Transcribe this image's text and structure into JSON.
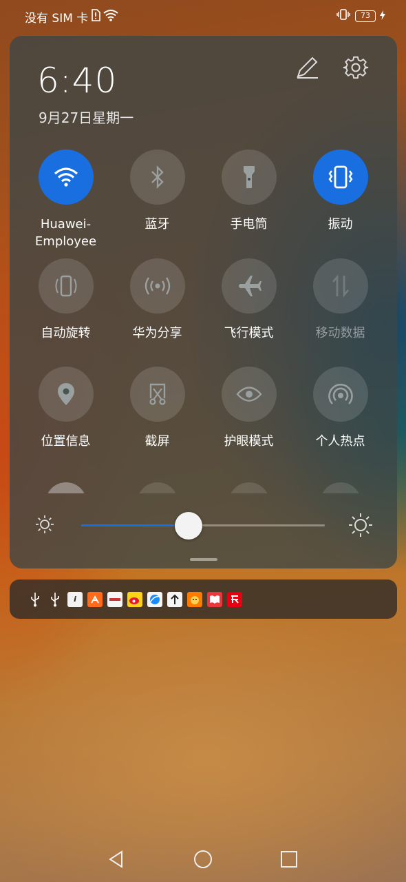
{
  "status_bar": {
    "carrier": "没有 SIM 卡",
    "battery": "73"
  },
  "panel": {
    "time": "6:40",
    "date": "9月27日星期一"
  },
  "tiles": [
    {
      "label": "Huawei-\nEmployee",
      "icon": "wifi-icon",
      "state": "active"
    },
    {
      "label": "蓝牙",
      "icon": "bluetooth-icon",
      "state": "off"
    },
    {
      "label": "手电筒",
      "icon": "flashlight-icon",
      "state": "off"
    },
    {
      "label": "振动",
      "icon": "vibrate-icon",
      "state": "active"
    },
    {
      "label": "自动旋转",
      "icon": "rotate-icon",
      "state": "off"
    },
    {
      "label": "华为分享",
      "icon": "share-icon",
      "state": "off"
    },
    {
      "label": "飞行模式",
      "icon": "airplane-icon",
      "state": "off"
    },
    {
      "label": "移动数据",
      "icon": "mobile-data-icon",
      "state": "disabled"
    },
    {
      "label": "位置信息",
      "icon": "location-icon",
      "state": "off"
    },
    {
      "label": "截屏",
      "icon": "screenshot-icon",
      "state": "off"
    },
    {
      "label": "护眼模式",
      "icon": "eye-icon",
      "state": "off"
    },
    {
      "label": "个人热点",
      "icon": "hotspot-icon",
      "state": "off"
    }
  ],
  "brightness": {
    "level": 0.44
  },
  "colors": {
    "accent": "#1a6fe0",
    "panel": "#3c4646"
  },
  "notification_icons": [
    "usb-icon",
    "usb-icon",
    "info-app-icon",
    "app-icon-orange",
    "huawei-app-icon",
    "weibo-icon",
    "browser-icon",
    "upload-icon",
    "app-icon-tiger",
    "reader-icon",
    "app-icon-red"
  ],
  "nav": [
    "back-icon",
    "home-icon",
    "recents-icon"
  ]
}
